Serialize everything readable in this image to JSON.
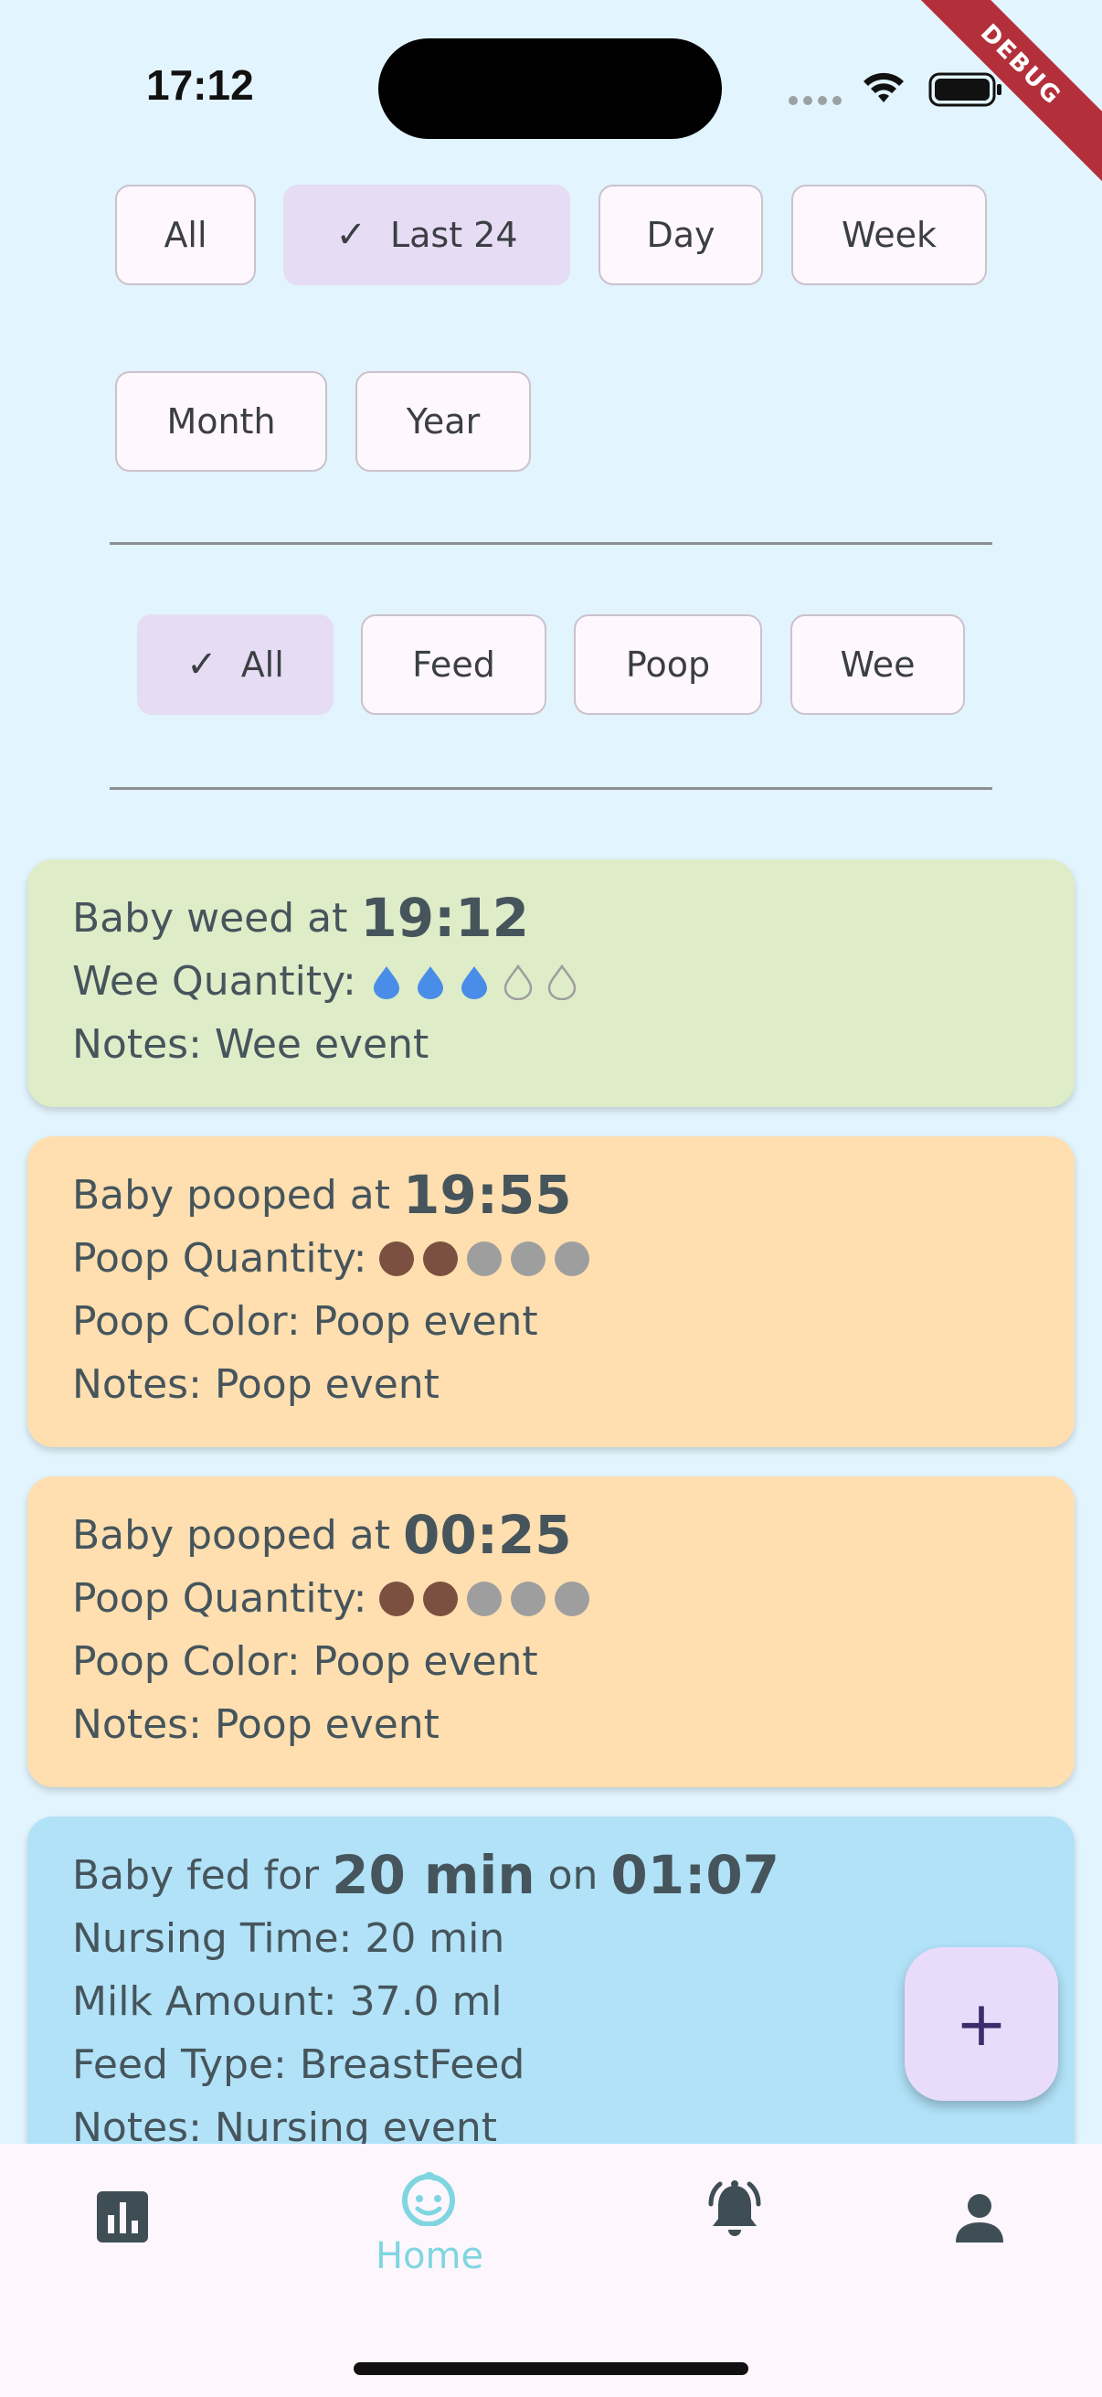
{
  "status_bar": {
    "time": "17:12",
    "debug_banner": "DEBUG"
  },
  "time_filters": [
    {
      "label": "All",
      "selected": false
    },
    {
      "label": "Last 24",
      "selected": true
    },
    {
      "label": "Day",
      "selected": false
    },
    {
      "label": "Week",
      "selected": false
    },
    {
      "label": "Month",
      "selected": false
    },
    {
      "label": "Year",
      "selected": false
    }
  ],
  "type_filters": [
    {
      "label": "All",
      "selected": true
    },
    {
      "label": "Feed",
      "selected": false
    },
    {
      "label": "Poop",
      "selected": false
    },
    {
      "label": "Wee",
      "selected": false
    }
  ],
  "events": [
    {
      "kind": "wee",
      "title_prefix": "Baby weed at",
      "time": "19:12",
      "quantity_label": "Wee Quantity:",
      "quantity": 3,
      "quantity_max": 5,
      "notes": "Notes: Wee event"
    },
    {
      "kind": "poop",
      "title_prefix": "Baby pooped at",
      "time": "19:55",
      "quantity_label": "Poop Quantity:",
      "quantity": 2,
      "quantity_max": 5,
      "color_line": "Poop Color: Poop event",
      "notes": "Notes: Poop event"
    },
    {
      "kind": "poop",
      "title_prefix": "Baby pooped at",
      "time": "00:25",
      "quantity_label": "Poop Quantity:",
      "quantity": 2,
      "quantity_max": 5,
      "color_line": "Poop Color: Poop event",
      "notes": "Notes: Poop event"
    },
    {
      "kind": "feed",
      "title_prefix": "Baby fed for",
      "duration": "20 min",
      "title_mid": "on",
      "time": "01:07",
      "nursing_time": "Nursing Time: 20 min",
      "milk_amount": "Milk Amount: 37.0 ml",
      "feed_type": "Feed Type: BreastFeed",
      "notes": "Notes: Nursing event"
    }
  ],
  "fab": {
    "label": "+"
  },
  "bottom_nav": [
    {
      "icon": "bar-chart-icon",
      "label": ""
    },
    {
      "icon": "baby-face-icon",
      "label": "Home",
      "active": true
    },
    {
      "icon": "bell-alert-icon",
      "label": ""
    },
    {
      "icon": "person-icon",
      "label": ""
    }
  ],
  "colors": {
    "background": "#e2f4fd",
    "wee_card": "#dfecc8",
    "poop_card": "#ffdfb0",
    "feed_card": "#b1e2f8",
    "drop_filled": "#4a8de8",
    "poop_dot_filled": "#7b5040",
    "dot_empty": "#9e9e9e",
    "nav_active": "#7fd6e0"
  }
}
